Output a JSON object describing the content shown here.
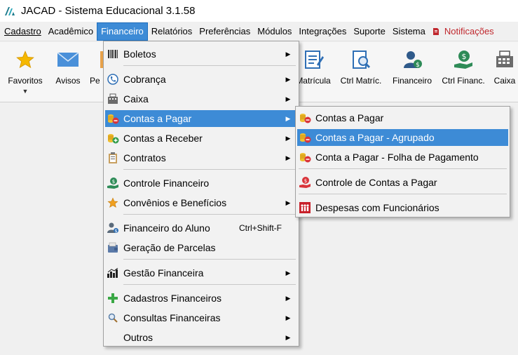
{
  "window": {
    "title": "JACAD - Sistema Educacional 3.1.58"
  },
  "menubar": {
    "items": [
      "Cadastro",
      "Acadêmico",
      "Financeiro",
      "Relatórios",
      "Preferências",
      "Módulos",
      "Integrações",
      "Suporte",
      "Sistema"
    ],
    "active": "Financeiro",
    "notifications": "Notificações"
  },
  "toolbar": {
    "favoritos": "Favoritos",
    "avisos": "Avisos",
    "pe": "Pe",
    "matricula": "Matrícula",
    "ctrl_matric": "Ctrl Matríc.",
    "financeiro": "Financeiro",
    "ctrl_financ": "Ctrl Financ.",
    "caixa": "Caixa"
  },
  "financeiro_menu": {
    "boletos": "Boletos",
    "cobranca": "Cobrança",
    "caixa": "Caixa",
    "contas_pagar": "Contas a Pagar",
    "contas_receber": "Contas a Receber",
    "contratos": "Contratos",
    "controle_financeiro": "Controle Financeiro",
    "convenios": "Convênios e Benefícios",
    "financeiro_aluno": "Financeiro do Aluno",
    "financeiro_aluno_shortcut": "Ctrl+Shift-F",
    "geracao_parcelas": "Geração de Parcelas",
    "gestao_financeira": "Gestão Financeira",
    "cadastros_financeiros": "Cadastros Financeiros",
    "consultas_financeiras": "Consultas Financeiras",
    "outros": "Outros"
  },
  "contas_pagar_submenu": {
    "contas_pagar": "Contas a Pagar",
    "contas_pagar_agrupado": "Contas a Pagar - Agrupado",
    "folha_pagamento": "Conta a Pagar - Folha de Pagamento",
    "controle_contas": "Controle de Contas a Pagar",
    "despesas_funcionarios": "Despesas com Funcionários"
  },
  "colors": {
    "highlight": "#3d8bd6",
    "notification_red": "#c0282e",
    "menu_bg": "#f2f2f2"
  }
}
